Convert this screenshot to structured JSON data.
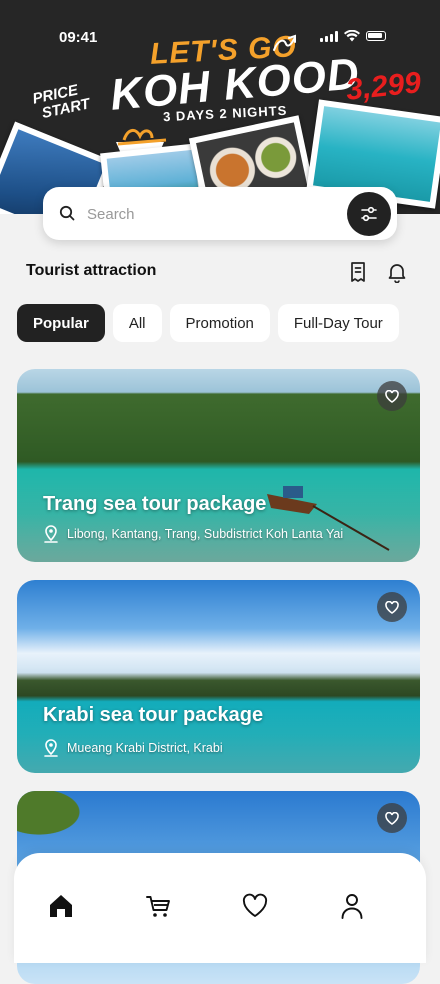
{
  "status_bar": {
    "time": "09:41"
  },
  "banner": {
    "headline": "LET'S GO",
    "destination": "KOH KOOD",
    "duration": "3 DAYS 2 NIGHTS",
    "price_start_line1": "PRICE",
    "price_start_line2": "START",
    "price": "3,299"
  },
  "search": {
    "placeholder": "Search"
  },
  "section": {
    "title": "Tourist attraction"
  },
  "tabs": [
    {
      "label": "Popular",
      "active": true
    },
    {
      "label": "All"
    },
    {
      "label": "Promotion"
    },
    {
      "label": "Full-Day Tour"
    }
  ],
  "cards": [
    {
      "title": "Trang sea tour package",
      "location": "Libong, Kantang, Trang, Subdistrict Koh Lanta Yai"
    },
    {
      "title": "Krabi sea tour package",
      "location": "Mueang Krabi District, Krabi"
    },
    {
      "title": "",
      "location": ""
    }
  ],
  "icons": {
    "home": "home-icon",
    "cart": "cart-icon",
    "favorites": "heart-icon",
    "profile": "user-icon",
    "receipt": "receipt-icon",
    "notification": "bell-icon"
  }
}
